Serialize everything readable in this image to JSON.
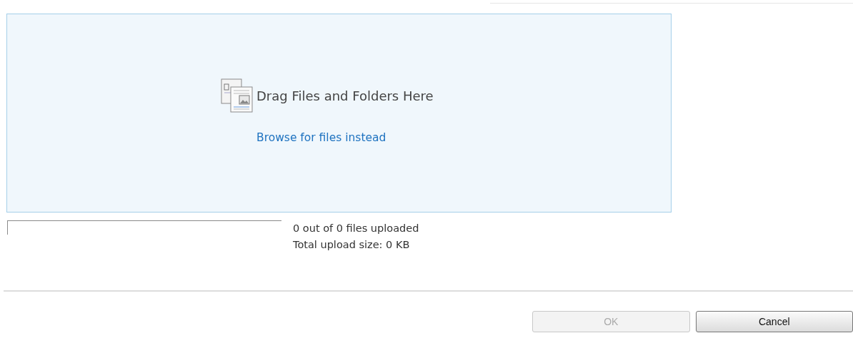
{
  "drop_zone": {
    "heading": "Drag Files and Folders Here",
    "browse_link": "Browse for files instead"
  },
  "progress": {
    "level": 0,
    "files_status": "0 out of 0 files uploaded",
    "size_status": "Total upload size: 0 KB"
  },
  "buttons": [
    {
      "label": "OK",
      "disabled": true
    },
    {
      "label": "Cancel",
      "disabled": false
    }
  ]
}
